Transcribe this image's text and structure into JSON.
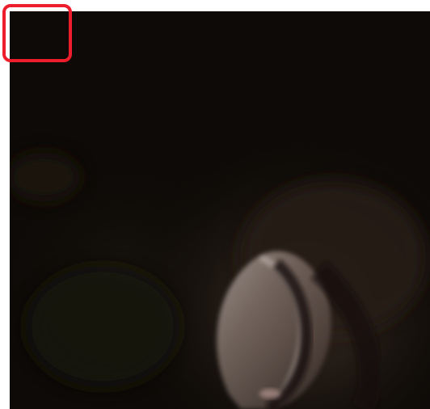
{
  "image": {
    "scene": "dark-night-photo",
    "highlight_color": "#ee1d2b",
    "background_color": "#0d0a07"
  }
}
